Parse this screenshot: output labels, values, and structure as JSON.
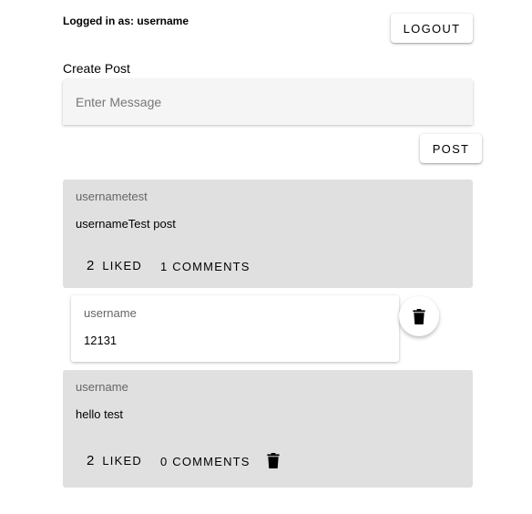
{
  "header": {
    "login_status": "Logged in as: username",
    "logout_label": "Logout"
  },
  "create_post": {
    "label": "Create Post",
    "input_placeholder": "Enter Message",
    "input_value": "",
    "post_label": "Post"
  },
  "posts": [
    {
      "username": "usernametest",
      "text": "usernameTest post",
      "like_count": "2",
      "like_label": "Liked",
      "comments_label": "1 Comments",
      "comments": [
        {
          "username": "username",
          "text": "12131"
        }
      ]
    },
    {
      "username": "username",
      "text": "hello test",
      "like_count": "2",
      "like_label": "Liked",
      "comments_label": "0 Comments",
      "comments": []
    }
  ],
  "icons": {
    "delete": "trash-icon"
  },
  "colors": {
    "card_background": "#e0e0e0",
    "input_background": "#f5f5f5",
    "page_background": "#ffffff"
  }
}
